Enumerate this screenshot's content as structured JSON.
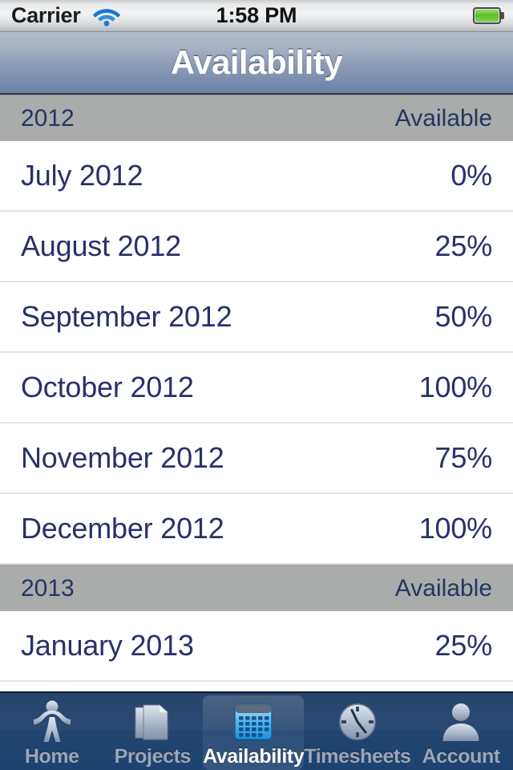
{
  "status_bar": {
    "carrier": "Carrier",
    "wifi_icon": "wifi-icon",
    "time": "1:58 PM",
    "battery_icon": "battery-full-icon"
  },
  "nav_bar": {
    "title": "Availability"
  },
  "list": {
    "sections": [
      {
        "header_left": "2012",
        "header_right": "Available",
        "rows": [
          {
            "label": "July 2012",
            "value": "0%"
          },
          {
            "label": "August 2012",
            "value": "25%"
          },
          {
            "label": "September 2012",
            "value": "50%"
          },
          {
            "label": "October 2012",
            "value": "100%"
          },
          {
            "label": "November 2012",
            "value": "75%"
          },
          {
            "label": "December 2012",
            "value": "100%"
          }
        ]
      },
      {
        "header_left": "2013",
        "header_right": "Available",
        "rows": [
          {
            "label": "January 2013",
            "value": "25%"
          }
        ]
      }
    ]
  },
  "tab_bar": {
    "tabs": [
      {
        "label": "Home",
        "icon": "person-jumping-icon",
        "selected": false
      },
      {
        "label": "Projects",
        "icon": "documents-icon",
        "selected": false
      },
      {
        "label": "Availability",
        "icon": "calendar-grid-icon",
        "selected": true
      },
      {
        "label": "Timesheets",
        "icon": "clock-icon",
        "selected": false
      },
      {
        "label": "Account",
        "icon": "person-silhouette-icon",
        "selected": false
      }
    ]
  },
  "colors": {
    "nav_bar_top": "#b4bece",
    "nav_bar_bottom": "#6b81a4",
    "section_header_bg": "#aaabab",
    "row_text": "#29306b",
    "tab_bar_bg": "#21456f",
    "tab_label_inactive": "#9aa7b8",
    "tab_label_active": "#ffffff",
    "accent_blue": "#4ab4ef",
    "battery_green": "#5cc02a"
  }
}
